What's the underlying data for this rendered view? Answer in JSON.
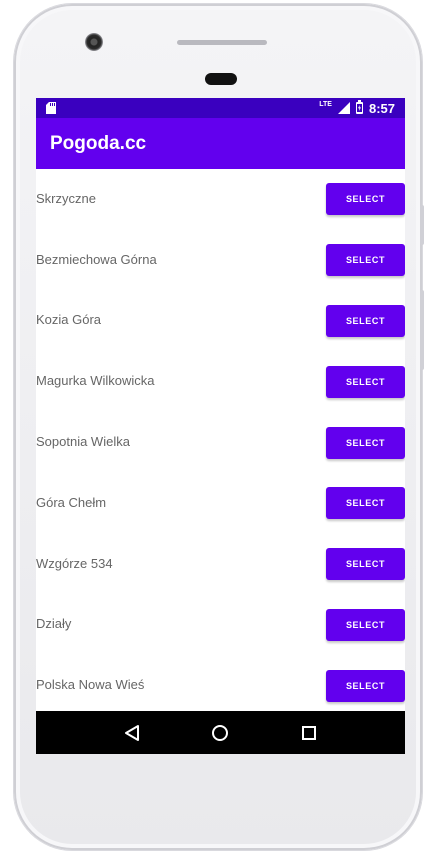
{
  "status_bar": {
    "network": "LTE",
    "time": "8:57"
  },
  "app_bar": {
    "title": "Pogoda.cc"
  },
  "locations": [
    {
      "name": "Skrzyczne",
      "button": "SELECT"
    },
    {
      "name": "Bezmiechowa Górna",
      "button": "SELECT"
    },
    {
      "name": "Kozia Góra",
      "button": "SELECT"
    },
    {
      "name": "Magurka Wilkowicka",
      "button": "SELECT"
    },
    {
      "name": "Sopotnia Wielka",
      "button": "SELECT"
    },
    {
      "name": "Góra Chełm",
      "button": "SELECT"
    },
    {
      "name": "Wzgórze 534",
      "button": "SELECT"
    },
    {
      "name": "Działy",
      "button": "SELECT"
    },
    {
      "name": "Polska Nowa Wieś",
      "button": "SELECT"
    }
  ],
  "colors": {
    "primary": "#6200ee",
    "status_bar": "#3a00bf",
    "nav_bar": "#000000"
  },
  "icons": {
    "sd_card": "sd-card-icon",
    "signal": "signal-icon",
    "battery": "battery-charging-icon",
    "back": "back-icon",
    "home": "home-icon",
    "recents": "recents-icon"
  }
}
